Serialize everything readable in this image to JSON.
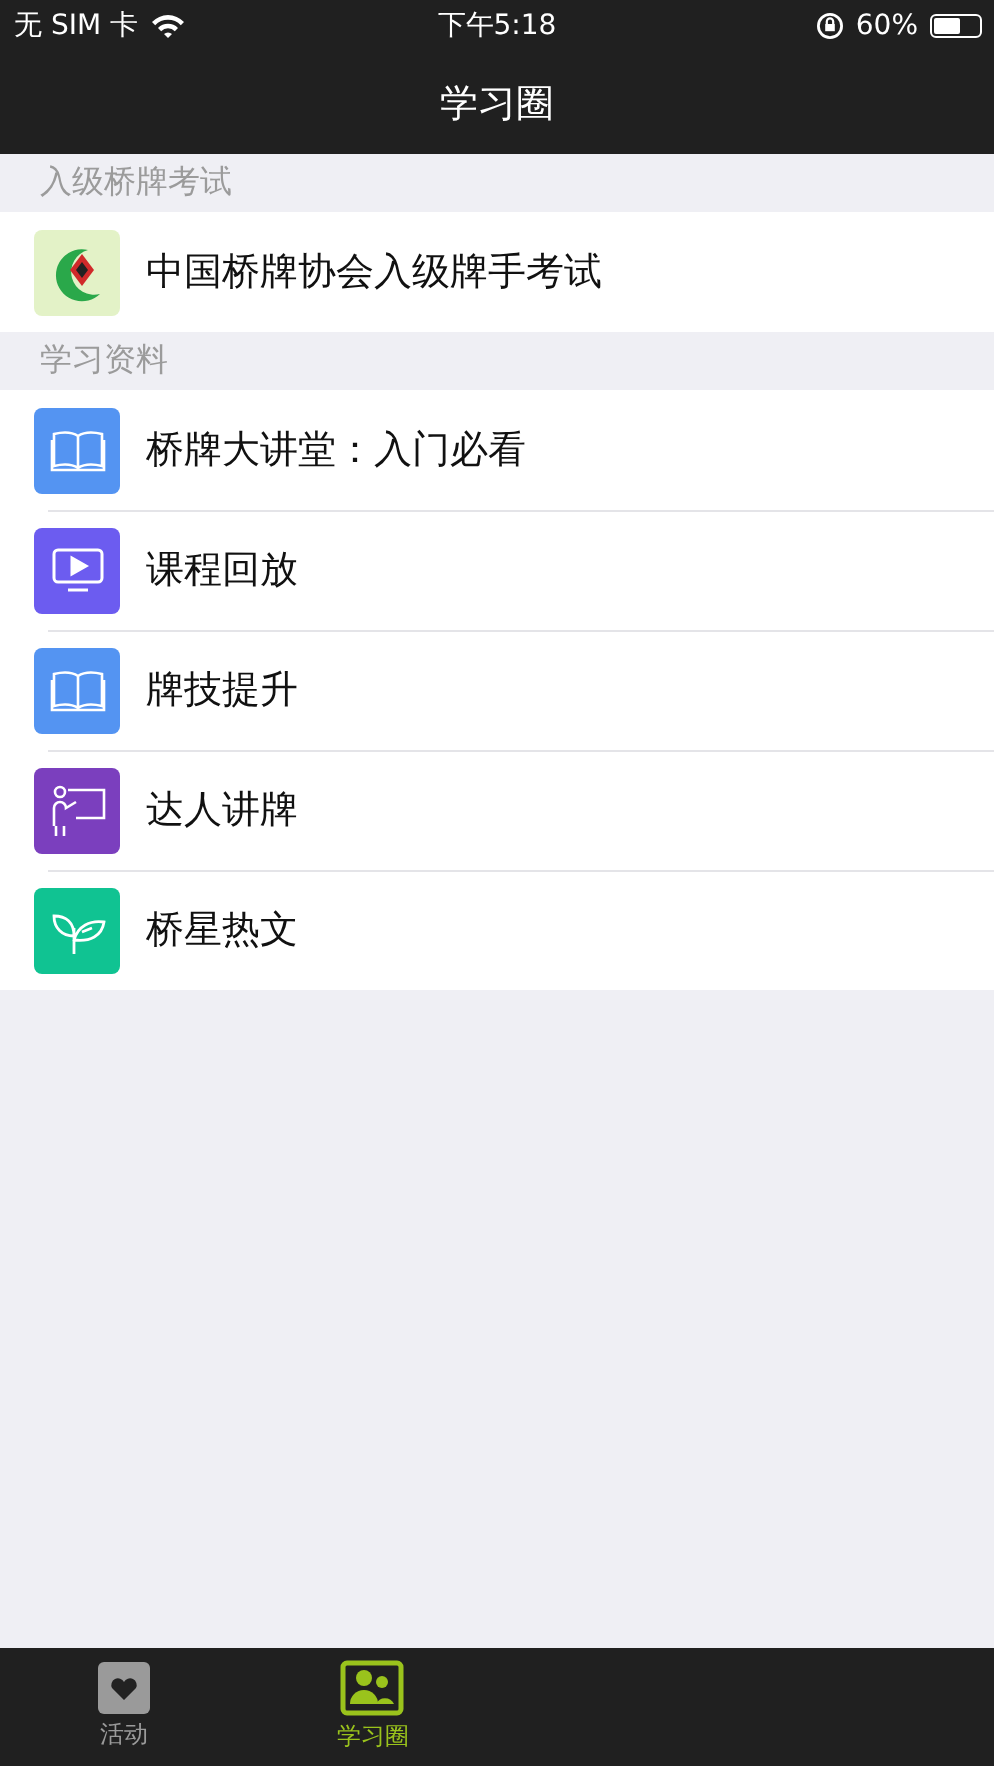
{
  "status_bar": {
    "carrier": "无 SIM 卡",
    "time": "下午5:18",
    "battery": "60%"
  },
  "nav": {
    "title": "学习圈"
  },
  "sections": [
    {
      "header": "入级桥牌考试",
      "items": [
        {
          "label": "中国桥牌协会入级牌手考试",
          "kind": "logo"
        }
      ]
    },
    {
      "header": "学习资料",
      "items": [
        {
          "label": "桥牌大讲堂：入门必看",
          "kind": "book",
          "color": "#5494f2"
        },
        {
          "label": "课程回放",
          "kind": "video",
          "color": "#6c5cf0"
        },
        {
          "label": "牌技提升",
          "kind": "book",
          "color": "#5494f2"
        },
        {
          "label": "达人讲牌",
          "kind": "teacher",
          "color": "#7b3fbe"
        },
        {
          "label": "桥星热文",
          "kind": "leaf",
          "color": "#10c392"
        }
      ]
    }
  ],
  "tabs": [
    {
      "label": "活动",
      "kind": "heart",
      "selected": false
    },
    {
      "label": "学习圈",
      "kind": "people",
      "selected": true
    }
  ]
}
